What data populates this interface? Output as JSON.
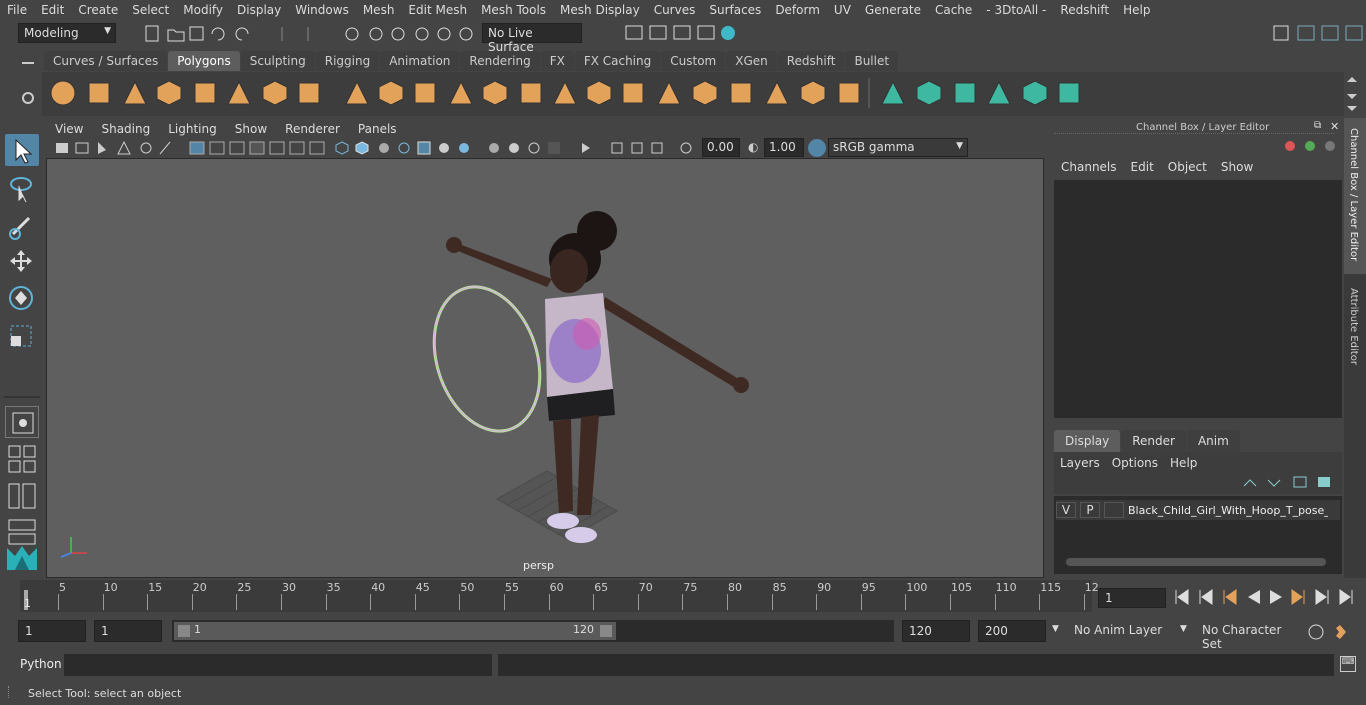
{
  "menubar": {
    "items": [
      "File",
      "Edit",
      "Create",
      "Select",
      "Modify",
      "Display",
      "Windows",
      "Mesh",
      "Edit Mesh",
      "Mesh Tools",
      "Mesh Display",
      "Curves",
      "Surfaces",
      "Deform",
      "UV",
      "Generate",
      "Cache",
      "- 3DtoAll -",
      "Redshift",
      "Help"
    ]
  },
  "statusline": {
    "mode": "Modeling",
    "live_surface": "No Live Surface"
  },
  "shelf": {
    "tabs": [
      "Curves / Surfaces",
      "Polygons",
      "Sculpting",
      "Rigging",
      "Animation",
      "Rendering",
      "FX",
      "FX Caching",
      "Custom",
      "XGen",
      "Redshift",
      "Bullet"
    ],
    "active": "Polygons"
  },
  "viewport": {
    "menu": [
      "View",
      "Shading",
      "Lighting",
      "Show",
      "Renderer",
      "Panels"
    ],
    "exposure": "0.00",
    "gamma": "1.00",
    "color_space": "sRGB gamma",
    "camera_label": "persp"
  },
  "channelbox": {
    "title": "Channel Box / Layer Editor",
    "menu": [
      "Channels",
      "Edit",
      "Object",
      "Show"
    ],
    "layer_tabs": [
      "Display",
      "Render",
      "Anim"
    ],
    "active_layer_tab": "Display",
    "layer_menu": [
      "Layers",
      "Options",
      "Help"
    ],
    "layer": {
      "v": "V",
      "p": "P",
      "name": "Black_Child_Girl_With_Hoop_T_pose_"
    }
  },
  "sidetabs": [
    "Channel Box / Layer Editor",
    "Attribute Editor"
  ],
  "timeline": {
    "ticks": [
      "5",
      "10",
      "15",
      "20",
      "25",
      "30",
      "35",
      "40",
      "45",
      "50",
      "55",
      "60",
      "65",
      "70",
      "75",
      "80",
      "85",
      "90",
      "95",
      "100",
      "105",
      "110",
      "115",
      "12"
    ],
    "start_marker": "1",
    "current_frame": "1"
  },
  "range": {
    "start": "1",
    "playback_start": "1",
    "slider_start": "1",
    "slider_end": "120",
    "playback_end": "120",
    "end": "200",
    "anim_layer": "No Anim Layer",
    "character_set": "No Character Set"
  },
  "cmdline": {
    "label": "Python"
  },
  "helpline": {
    "text": "Select Tool: select an object"
  },
  "colors": {
    "accent": "#5285a6",
    "tab_active": "#5d5d5d",
    "shelf_orange": "#e2a25a",
    "shelf_teal": "#3fb8a2"
  }
}
